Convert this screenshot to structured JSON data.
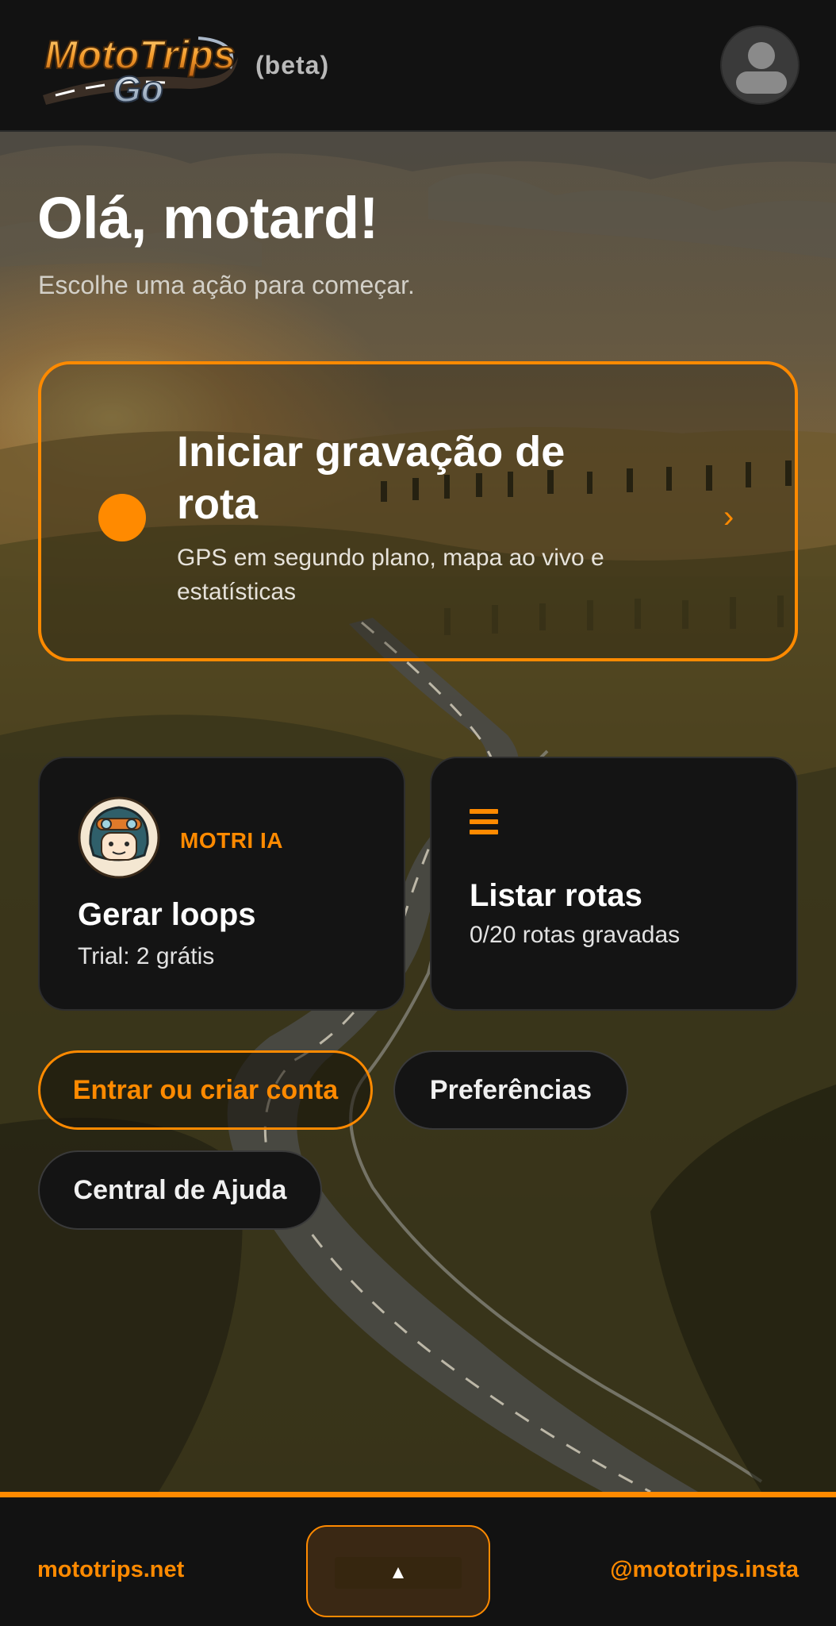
{
  "header": {
    "logo_text_top": "MotoTrips",
    "logo_text_bottom": "Go",
    "beta_label": "(beta)",
    "avatar_icon": "user-avatar-icon"
  },
  "greeting": {
    "title": "Olá, motard!",
    "subtitle": "Escolhe uma ação para começar."
  },
  "record_card": {
    "title": "Iniciar gravação de rota",
    "description": "GPS em segundo plano, mapa ao vivo e estatísticas",
    "chevron": "›",
    "dot_icon": "record-dot-icon",
    "accent_color": "#ff8a00"
  },
  "tiles": {
    "ai": {
      "tag": "MOTRI IA",
      "title": "Gerar loops",
      "subtitle": "Trial: 2 grátis",
      "icon": "motorcycle-helmet-mascot-icon"
    },
    "routes": {
      "title": "Listar rotas",
      "subtitle": "0/20 rotas gravadas",
      "icon": "list-icon"
    }
  },
  "buttons": {
    "login": "Entrar ou criar conta",
    "preferences": "Preferências",
    "help": "Central de Ajuda"
  },
  "footer": {
    "left_link": "mototrips.net",
    "right_link": "@mototrips.insta",
    "toggle_glyph": "▲"
  },
  "colors": {
    "accent": "#ff8a00",
    "background": "#121212",
    "card": "#141414"
  }
}
